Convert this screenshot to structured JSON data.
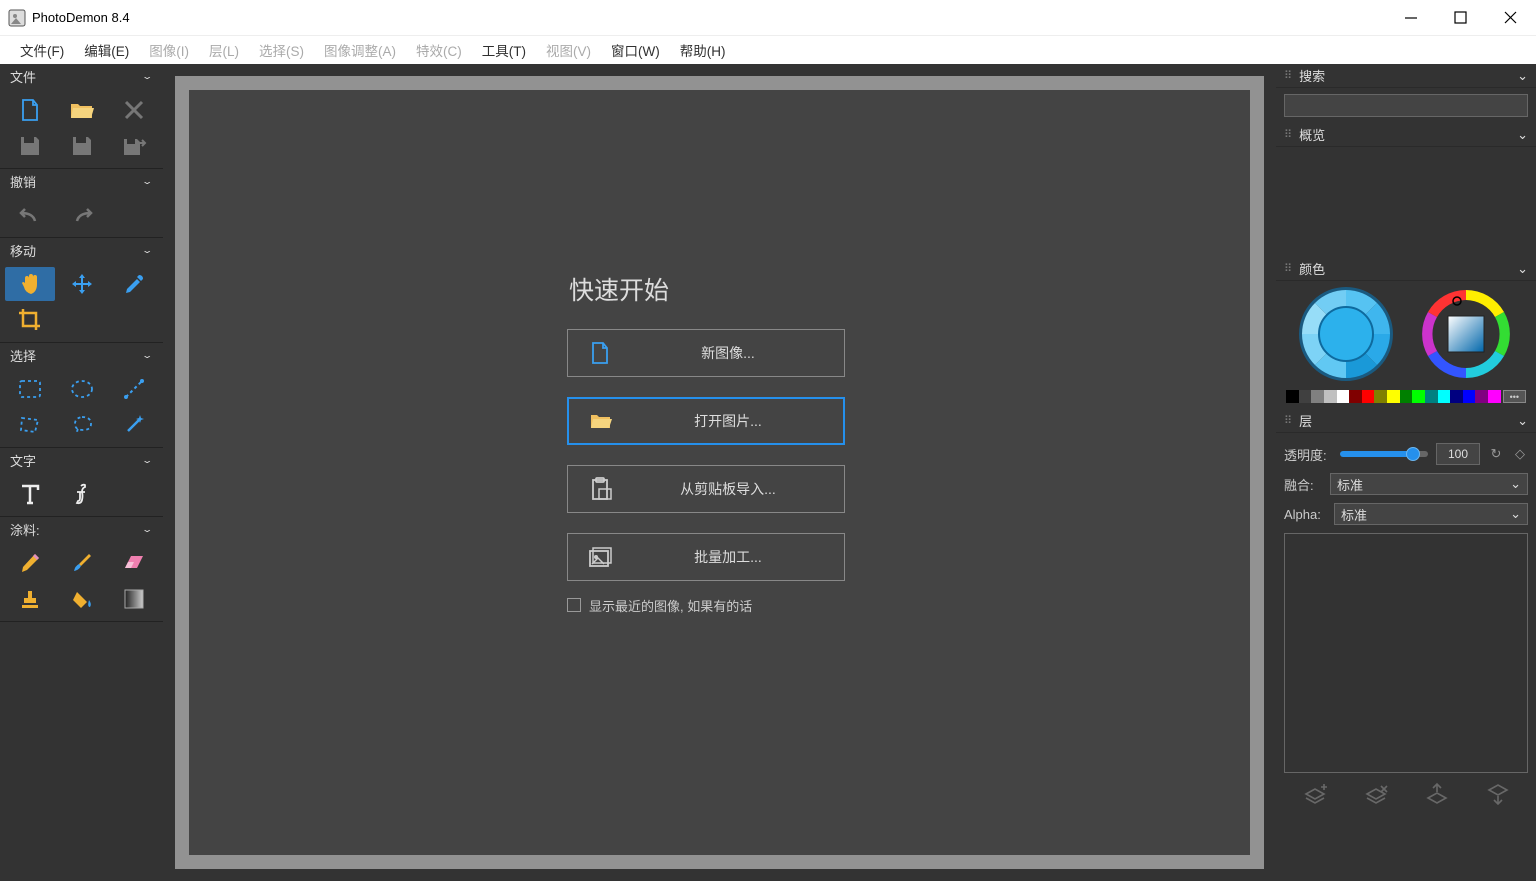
{
  "app": {
    "title": "PhotoDemon 8.4"
  },
  "menubar": [
    {
      "label": "文件(F)",
      "enabled": true
    },
    {
      "label": "编辑(E)",
      "enabled": true
    },
    {
      "label": "图像(I)",
      "enabled": false
    },
    {
      "label": "层(L)",
      "enabled": false
    },
    {
      "label": "选择(S)",
      "enabled": false
    },
    {
      "label": "图像调整(A)",
      "enabled": false
    },
    {
      "label": "特效(C)",
      "enabled": false
    },
    {
      "label": "工具(T)",
      "enabled": true
    },
    {
      "label": "视图(V)",
      "enabled": false
    },
    {
      "label": "窗口(W)",
      "enabled": true
    },
    {
      "label": "帮助(H)",
      "enabled": true
    }
  ],
  "toolbox": {
    "file": "文件",
    "undo": "撤销",
    "move": "移动",
    "select": "选择",
    "text": "文字",
    "paint": "涂料:"
  },
  "quickstart": {
    "title": "快速开始",
    "new_image": "新图像...",
    "open_image": "打开图片...",
    "from_clipboard": "从剪贴板导入...",
    "batch": "批量加工...",
    "recent_checkbox": "显示最近的图像, 如果有的话"
  },
  "panels": {
    "search": "搜索",
    "overview": "概览",
    "color": "颜色",
    "layers": "层",
    "opacity_label": "透明度:",
    "opacity_value": "100",
    "blend_label": "融合:",
    "blend_value": "标准",
    "alpha_label": "Alpha:",
    "alpha_value": "标准"
  },
  "swatches": [
    "#000000",
    "#404040",
    "#808080",
    "#c0c0c0",
    "#ffffff",
    "#800000",
    "#ff0000",
    "#808000",
    "#ffff00",
    "#008000",
    "#00ff00",
    "#008080",
    "#00ffff",
    "#000080",
    "#0000ff",
    "#800080",
    "#ff00ff"
  ]
}
